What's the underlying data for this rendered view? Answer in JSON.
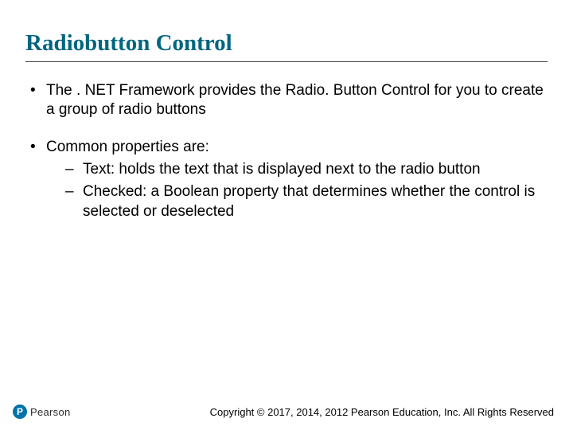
{
  "title": "Radiobutton Control",
  "bullets": {
    "b1": "The . NET Framework provides the Radio. Button Control for you to create a group of radio buttons",
    "b2": "Common properties are:",
    "b2_1_prefix": "Text",
    "b2_1_rest": ": holds the text that is displayed next to the radio button",
    "b2_2_prefix": "Checked",
    "b2_2_rest": ": a Boolean property that determines whether the control is selected or deselected"
  },
  "logo": {
    "mark": "P",
    "text": "Pearson"
  },
  "copyright": "Copyright © 2017, 2014, 2012 Pearson Education, Inc. All Rights Reserved"
}
